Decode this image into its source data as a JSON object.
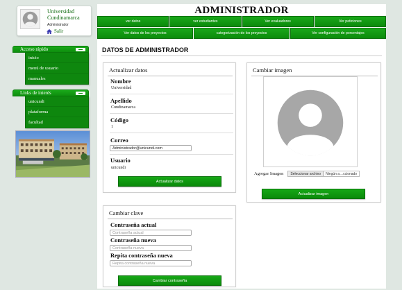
{
  "user_card": {
    "university_line1": "Universidad",
    "university_line2": "Cundinamarca",
    "role": "Administrador",
    "logout": "Salir"
  },
  "quick_access": {
    "title": "Acceso rápido",
    "items": [
      "inicio",
      "menú de usuario",
      "manuales"
    ]
  },
  "links": {
    "title": "Links de interés",
    "items": [
      "unicundi",
      "plataforma",
      "facultad"
    ]
  },
  "header": {
    "title": "ADMINISTRADOR",
    "nav_row1": [
      "ver datos",
      "ver estudiantes",
      "Ver evaluadores",
      "Ver peticiones"
    ],
    "nav_row2": [
      "Ver datos de los proyectos",
      "categorización de los proyectos",
      "Ver configuración de porcentajes"
    ]
  },
  "section_title": "DATOS DE ADMINISTRADOR",
  "update_panel": {
    "title": "Actualizar datos",
    "nombre_label": "Nombre",
    "nombre_value": "Universidad",
    "apellido_label": "Apellido",
    "apellido_value": "Cundinamarca",
    "codigo_label": "Código",
    "codigo_value": "1",
    "correo_label": "Correo",
    "correo_value": "Administrador@unicundi.com",
    "usuario_label": "Usuario",
    "usuario_value": "unicundi",
    "button": "Actualizar datos"
  },
  "image_panel": {
    "title": "Cambiar imagen",
    "file_label": "Agregar Imagen",
    "file_button": "Seleccionar archivo",
    "file_status": "Ningún a…ccionado",
    "button": "Actualizar imagen"
  },
  "password_panel": {
    "title": "Cambiar clave",
    "current_label": "Contraseña actual",
    "current_placeholder": "Contraseña actual",
    "new_label": "Contraseña nueva",
    "new_placeholder": "Contraseña nueva",
    "repeat_label": "Repita contraseña nueva",
    "repeat_placeholder": "Repita contraseña nueva",
    "button": "Cambiar contraseña"
  },
  "colors": {
    "accent_green": "#0e8e0e",
    "title_green": "#0f6a0f",
    "background": "#dfe7e2"
  },
  "icons": {
    "home": "home-icon",
    "avatar": "user-avatar-icon",
    "minus": "minus-icon"
  }
}
